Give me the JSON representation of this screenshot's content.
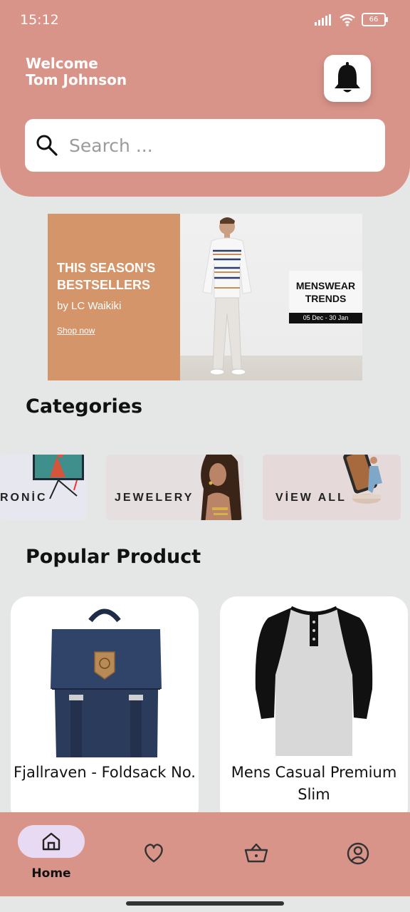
{
  "status_bar": {
    "time": "15:12",
    "battery": "66"
  },
  "header": {
    "welcome": "Welcome",
    "user_name": "Tom Johnson"
  },
  "search": {
    "placeholder": "Search ..."
  },
  "banner": {
    "title": "THIS SEASON'S BESTSELLERS",
    "subtitle": "by LC Waikiki",
    "link": "Shop now",
    "badge_title": "MENSWEAR TRENDS",
    "badge_date": "05 Dec - 30 Jan"
  },
  "categories": {
    "title": "Categories",
    "items": [
      {
        "label": "RONİC"
      },
      {
        "label": "JEWELERY"
      },
      {
        "label": "VİEW ALL"
      }
    ]
  },
  "popular": {
    "title": "Popular Product",
    "products": [
      {
        "name": "Fjallraven - Foldsack No."
      },
      {
        "name": "Mens Casual Premium Slim"
      }
    ]
  },
  "bottom_nav": {
    "home_label": "Home"
  },
  "icons": [
    "search-icon",
    "bell-icon",
    "home-icon",
    "heart-icon",
    "basket-icon",
    "profile-icon"
  ],
  "colors": {
    "accent": "#d9948a",
    "background": "#e4e7e6",
    "nav_pill": "#e8daf2"
  }
}
